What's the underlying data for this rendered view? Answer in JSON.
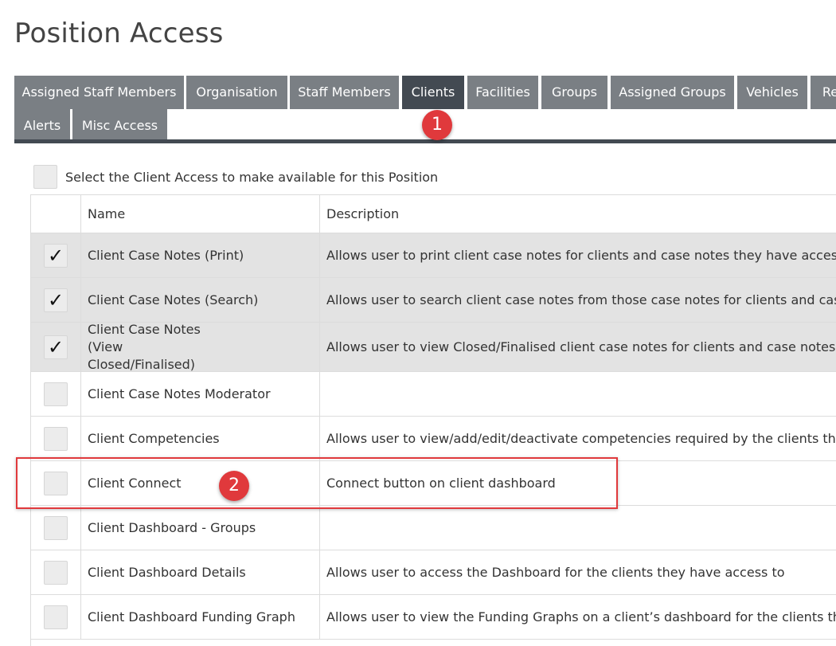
{
  "page_title": "Position Access",
  "tabs": [
    {
      "label": "Assigned Staff Members",
      "active": false
    },
    {
      "label": "Organisation",
      "active": false
    },
    {
      "label": "Staff Members",
      "active": false
    },
    {
      "label": "Clients",
      "active": true
    },
    {
      "label": "Facilities",
      "active": false
    },
    {
      "label": "Groups",
      "active": false
    },
    {
      "label": "Assigned Groups",
      "active": false
    },
    {
      "label": "Vehicles",
      "active": false
    },
    {
      "label": "Re",
      "active": false
    },
    {
      "label": "Alerts",
      "active": false
    },
    {
      "label": "Misc Access",
      "active": false
    }
  ],
  "select_all_label": "Select the Client Access to make available for this Position",
  "table": {
    "headers": {
      "name": "Name",
      "description": "Description"
    },
    "rows": [
      {
        "name": "Client Case Notes (Print)",
        "description": "Allows user to print client case notes for clients and case notes they have access to",
        "checked": true
      },
      {
        "name": "Client Case Notes (Search)",
        "description": "Allows user to search client case notes from those case notes for clients and case no",
        "checked": true
      },
      {
        "name": "Client Case Notes (View Closed/Finalised)",
        "description": "Allows user to view Closed/Finalised client case notes for clients and case notes the",
        "checked": true
      },
      {
        "name": "Client Case Notes Moderator",
        "description": "",
        "checked": false
      },
      {
        "name": "Client Competencies",
        "description": "Allows user to view/add/edit/deactivate competencies required by the clients they h",
        "checked": false
      },
      {
        "name": "Client Connect",
        "description": "Connect button on client dashboard",
        "checked": false
      },
      {
        "name": "Client Dashboard - Groups",
        "description": "",
        "checked": false
      },
      {
        "name": "Client Dashboard Details",
        "description": "Allows user to access the Dashboard for the clients they have access to",
        "checked": false
      },
      {
        "name": "Client Dashboard Funding Graph",
        "description": "Allows user to view the Funding Graphs on a client’s dashboard for the clients they",
        "checked": false
      }
    ]
  },
  "callouts": {
    "one": "1",
    "two": "2"
  },
  "check_glyph": "✓"
}
